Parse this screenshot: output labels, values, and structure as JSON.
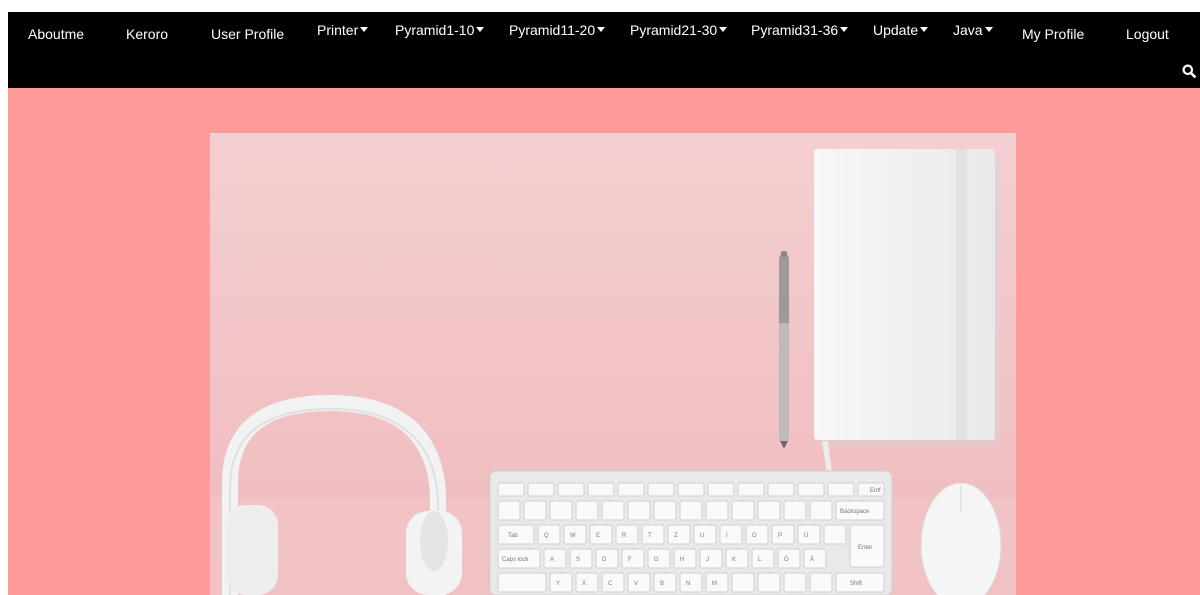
{
  "nav": {
    "items": [
      {
        "label": "Aboutme",
        "dropdown": false
      },
      {
        "label": "Keroro",
        "dropdown": false
      },
      {
        "label": "User Profile",
        "dropdown": false
      },
      {
        "label": "Printer",
        "dropdown": true
      },
      {
        "label": "Pyramid1-10",
        "dropdown": true
      },
      {
        "label": "Pyramid11-20",
        "dropdown": true
      },
      {
        "label": "Pyramid21-30",
        "dropdown": true
      },
      {
        "label": "Pyramid31-36",
        "dropdown": true
      },
      {
        "label": "Update",
        "dropdown": true
      },
      {
        "label": "Java",
        "dropdown": true
      },
      {
        "label": "My Profile",
        "dropdown": false
      },
      {
        "label": "Logout",
        "dropdown": false
      }
    ],
    "search_icon": "search-icon"
  },
  "colors": {
    "navbar_bg": "#000000",
    "page_bg": "#ff9b9b",
    "hero_bg": "#f2c3c6",
    "nav_text": "#ffffff"
  },
  "keyboard": {
    "keys": [
      "Entf",
      "Backspace",
      "Tab",
      "Caps lock",
      "Enter",
      "Shift",
      "Q",
      "W",
      "E",
      "R",
      "T",
      "Z",
      "U",
      "I",
      "O",
      "P",
      "Ü",
      "A",
      "S",
      "D",
      "F",
      "G",
      "H",
      "J",
      "K",
      "L",
      "Ö",
      "Ä",
      "Y",
      "X",
      "C",
      "V",
      "B",
      "N",
      "M"
    ]
  }
}
